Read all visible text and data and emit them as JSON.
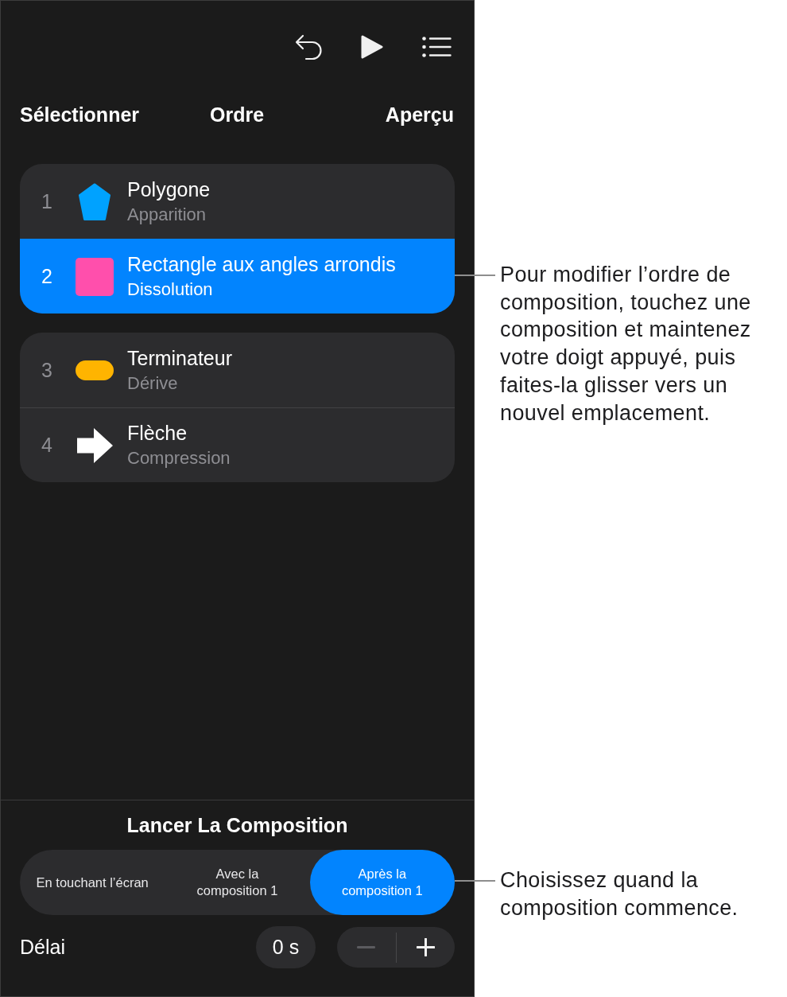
{
  "header": {
    "left": "Sélectionner",
    "title": "Ordre",
    "right": "Aperçu"
  },
  "groups": [
    {
      "items": [
        {
          "number": "1",
          "kind": "pentagon",
          "color": "#00a2ff",
          "title": "Polygone",
          "subtitle": "Apparition",
          "selected": false
        },
        {
          "number": "2",
          "kind": "rounded-square",
          "color": "#ff4fac",
          "title": "Rectangle aux angles arrondis",
          "subtitle": "Dissolution",
          "selected": true
        }
      ]
    },
    {
      "items": [
        {
          "number": "3",
          "kind": "capsule",
          "color": "#ffb400",
          "title": "Terminateur",
          "subtitle": "Dérive",
          "selected": false
        },
        {
          "number": "4",
          "kind": "arrow",
          "color": "#ffffff",
          "title": "Flèche",
          "subtitle": "Compression",
          "selected": false
        }
      ]
    }
  ],
  "start": {
    "title": "Lancer La Composition",
    "options": [
      {
        "label": "En touchant l’écran",
        "selected": false
      },
      {
        "label": "Avec la composition 1",
        "selected": false
      },
      {
        "label": "Après la composition 1",
        "selected": true
      }
    ]
  },
  "delay": {
    "label": "Délai",
    "value": "0 s",
    "decrement_disabled": true,
    "increment_disabled": false
  },
  "callouts": [
    {
      "text": "Pour modifier l’ordre de composition, touchez une composition et maintenez votre doigt appuyé, puis faites-la glisser vers un nouvel emplacement."
    },
    {
      "text": "Choisissez quand la composition commence."
    }
  ]
}
